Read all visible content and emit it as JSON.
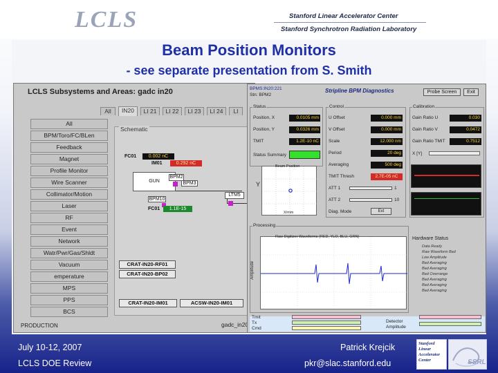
{
  "header": {
    "logo_text": "LCLS",
    "lab_line1": "Stanford Linear Accelerator Center",
    "lab_line2": "Stanford Synchrotron Radiation Laboratory"
  },
  "slide": {
    "title": "Beam Position Monitors",
    "subtitle": "- see separate presentation from S. Smith"
  },
  "left_window": {
    "title": "LCLS Subsystems and Areas: gadc in20",
    "tabs": [
      "All",
      "IN20",
      "LI 21",
      "LI 22",
      "LI 23",
      "LI 24",
      "LI"
    ],
    "active_tab": 1,
    "side_buttons": [
      "All",
      "BPM/Toro/FC/BLen",
      "Feedback",
      "Magnet",
      "Profile Monitor",
      "Wire Scanner",
      "Collimator/Motion",
      "Laser",
      "RF",
      "Event",
      "Network",
      "Watr/Pwr/Gas/Shldt",
      "Vacuum",
      "emperature",
      "MPS",
      "PPS",
      "BCS"
    ],
    "schematic_title": "Schematic",
    "fc01_label": "FC01",
    "fc01_value": "0.002 nC",
    "im01_label": "IM01",
    "im01_value": "0.292 nC",
    "gun_label": "GUN",
    "bpm2_label": "BPM2",
    "bpm3_label": "BPM3",
    "bpm10_label": "BPM10",
    "fc01b_label": "FC01",
    "fc01b_value": "1.1E-15",
    "ltm_label": "LTM5",
    "crates": [
      "CRAT-IN20-RF01",
      "CRAT-IN20-BP02",
      "CRAT-IN20-IM01",
      "ACSW-IN20-IM01"
    ],
    "production_label": "PRODUCTION",
    "gadc_label": "gadc_in20"
  },
  "right_window": {
    "pv_line1": "BPMS:IN20:221",
    "pv_line2": "Stn: BPM2",
    "title": "Stripline BPM Diagnostics",
    "buttons": [
      "Probe Screen",
      "Exit"
    ],
    "status_group": "Status",
    "status_rows": [
      {
        "label": "Position, X",
        "value": "0.0105 mm"
      },
      {
        "label": "Position, Y",
        "value": "0.0326 mm"
      },
      {
        "label": "TMIT",
        "value": "1.2E-10 nC"
      },
      {
        "label": "Status Summary",
        "value": ""
      }
    ],
    "control_group": "Control",
    "control_rows": [
      {
        "label": "U Offset",
        "value": "0.000 mm"
      },
      {
        "label": "V Offset",
        "value": "0.000 mm"
      },
      {
        "label": "Scale",
        "value": "12.000 nm"
      },
      {
        "label": "Period",
        "value": "20 deg"
      },
      {
        "label": "Averaging",
        "value": "500 deg"
      },
      {
        "label": "TMIT Thresh",
        "value": "2.7E-05 nC"
      },
      {
        "label": "ATT 1",
        "value": "1"
      },
      {
        "label": "ATT 2",
        "value": "10"
      },
      {
        "label": "Diag. Mode",
        "value": "Ext"
      }
    ],
    "cal_group": "Calibration",
    "cal_rows": [
      {
        "label": "Gain Ratio U",
        "value": "0.030"
      },
      {
        "label": "Gain Ratio V",
        "value": "0.0472"
      },
      {
        "label": "Gain Ratio TMIT",
        "value": "0.7512"
      },
      {
        "label": "X [Y]",
        "value": ""
      }
    ],
    "beam_position_label": "Beam Position",
    "x_axis_label": "X/mm",
    "y_axis_label": "Y",
    "waveform_group": "Processing",
    "waveform_title": "Raw Digitizer Waveforms (RED, YLO, BLU, GRN)",
    "waveform_y_label": "Amplitude",
    "hardware_status_title": "Hardware Status",
    "legend_items": [
      "Data Ready",
      "Raw Waveform Bad",
      "Low Amplitude",
      "Bad Averaging",
      "Bad Averaging",
      "Bad Overrange",
      "Bad Averaging",
      "Bad Averaging",
      "Bad Averaging"
    ],
    "amp_label1": "Detector",
    "amp_label2": "Amplitude",
    "bottom_labels": [
      "Tmit",
      "Tx",
      "Cmd"
    ]
  },
  "footer": {
    "date": "July 10-12, 2007",
    "event": "LCLS DOE Review",
    "presenter": "Patrick Krejcik",
    "email": "pkr@slac.stanford.edu",
    "slac_logo_lines": [
      "Stanford",
      "Linear",
      "Accelerator",
      "Center"
    ],
    "ssrl_text": "SSRL"
  }
}
